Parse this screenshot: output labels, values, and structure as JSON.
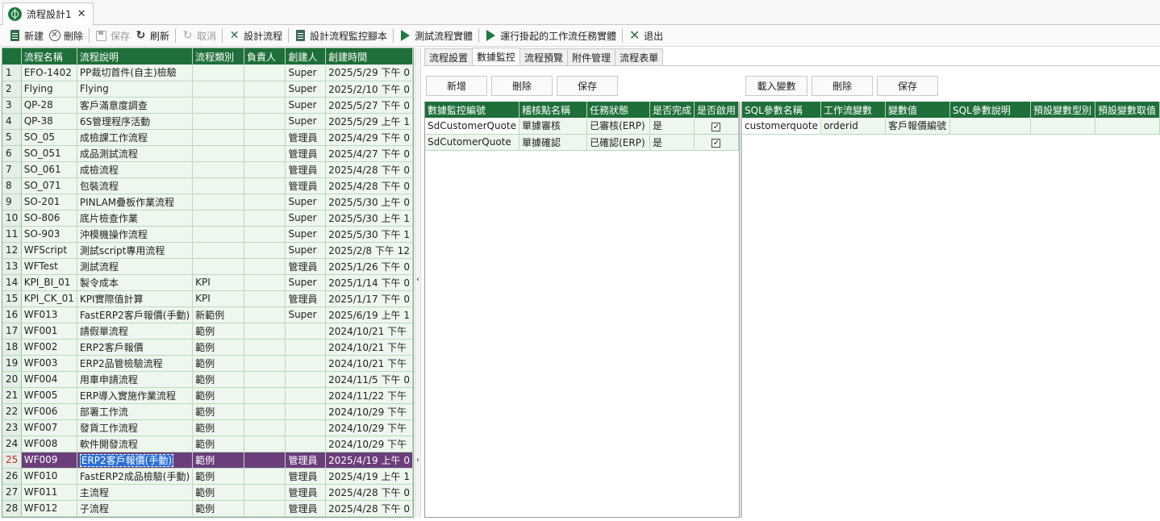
{
  "document_tab": {
    "title": "流程設計1",
    "close": "✕"
  },
  "toolbar": {
    "new": "新建",
    "delete": "刪除",
    "save": "保存",
    "refresh": "刷新",
    "cancel": "取消",
    "design_flow": "設計流程",
    "design_monitor_script": "設計流程監控腳本",
    "test_instance": "測試流程實體",
    "run_pending": "運行掛起的工作流任務實體",
    "exit": "退出"
  },
  "flow_grid": {
    "columns": [
      "流程名稱",
      "流程說明",
      "流程類別",
      "負責人",
      "創建人",
      "創建時間"
    ],
    "selected_row": 25,
    "rows": [
      {
        "n": "1",
        "name": "EFO-1402",
        "desc": "PP裁切首件(自主)檢驗",
        "cat": "",
        "owner": "",
        "creator": "Super",
        "time": "2025/5/29 下午 0"
      },
      {
        "n": "2",
        "name": "Flying",
        "desc": "Flying",
        "cat": "",
        "owner": "",
        "creator": "Super",
        "time": "2025/2/10 下午 0"
      },
      {
        "n": "3",
        "name": "QP-28",
        "desc": "客戶滿意度調查",
        "cat": "",
        "owner": "",
        "creator": "Super",
        "time": "2025/5/27 下午 0"
      },
      {
        "n": "4",
        "name": "QP-38",
        "desc": "6S管理程序活動",
        "cat": "",
        "owner": "",
        "creator": "Super",
        "time": "2025/5/29 上午 1"
      },
      {
        "n": "5",
        "name": "SO_05",
        "desc": "成檢課工作流程",
        "cat": "",
        "owner": "",
        "creator": "管理員",
        "time": "2025/4/29 下午 0"
      },
      {
        "n": "6",
        "name": "SO_051",
        "desc": "成品測試流程",
        "cat": "",
        "owner": "",
        "creator": "管理員",
        "time": "2025/4/27 下午 0"
      },
      {
        "n": "7",
        "name": "SO_061",
        "desc": "成檢流程",
        "cat": "",
        "owner": "",
        "creator": "管理員",
        "time": "2025/4/28 下午 0"
      },
      {
        "n": "8",
        "name": "SO_071",
        "desc": "包裝流程",
        "cat": "",
        "owner": "",
        "creator": "管理員",
        "time": "2025/4/28 下午 0"
      },
      {
        "n": "9",
        "name": "SO-201",
        "desc": "PINLAM疊板作業流程",
        "cat": "",
        "owner": "",
        "creator": "Super",
        "time": "2025/5/30 上午 0"
      },
      {
        "n": "10",
        "name": "SO-806",
        "desc": "底片檢查作業",
        "cat": "",
        "owner": "",
        "creator": "Super",
        "time": "2025/5/30 上午 1"
      },
      {
        "n": "11",
        "name": "SO-903",
        "desc": "沖模機操作流程",
        "cat": "",
        "owner": "",
        "creator": "Super",
        "time": "2025/5/30 下午 1"
      },
      {
        "n": "12",
        "name": "WFScript",
        "desc": "測試script專用流程",
        "cat": "",
        "owner": "",
        "creator": "Super",
        "time": "2025/2/8 下午 12"
      },
      {
        "n": "13",
        "name": "WFTest",
        "desc": "測試流程",
        "cat": "",
        "owner": "",
        "creator": "管理員",
        "time": "2025/1/26 下午 0"
      },
      {
        "n": "14",
        "name": "KPI_BI_01",
        "desc": "製令成本",
        "cat": "KPI",
        "owner": "",
        "creator": "Super",
        "time": "2025/1/14 下午 0"
      },
      {
        "n": "15",
        "name": "KPI_CK_01",
        "desc": "KPI實際值計算",
        "cat": "KPI",
        "owner": "",
        "creator": "管理員",
        "time": "2025/1/17 下午 0"
      },
      {
        "n": "16",
        "name": "WF013",
        "desc": "FastERP2客戶報價(手動)",
        "cat": "新範例",
        "owner": "",
        "creator": "Super",
        "time": "2025/6/19 上午 1"
      },
      {
        "n": "17",
        "name": "WF001",
        "desc": "請假單流程",
        "cat": "範例",
        "owner": "",
        "creator": "",
        "time": "2024/10/21 下午"
      },
      {
        "n": "18",
        "name": "WF002",
        "desc": "ERP2客戶報價",
        "cat": "範例",
        "owner": "",
        "creator": "",
        "time": "2024/10/21 下午"
      },
      {
        "n": "19",
        "name": "WF003",
        "desc": "ERP2品管檢驗流程",
        "cat": "範例",
        "owner": "",
        "creator": "",
        "time": "2024/10/21 下午"
      },
      {
        "n": "20",
        "name": "WF004",
        "desc": "用車申請流程",
        "cat": "範例",
        "owner": "",
        "creator": "",
        "time": "2024/11/5 下午 0"
      },
      {
        "n": "21",
        "name": "WF005",
        "desc": "ERP導入實施作業流程",
        "cat": "範例",
        "owner": "",
        "creator": "",
        "time": "2024/11/22 下午"
      },
      {
        "n": "22",
        "name": "WF006",
        "desc": "部署工作流",
        "cat": "範例",
        "owner": "",
        "creator": "",
        "time": "2024/10/29 下午"
      },
      {
        "n": "23",
        "name": "WF007",
        "desc": "發貨工作流程",
        "cat": "範例",
        "owner": "",
        "creator": "",
        "time": "2024/10/29 下午"
      },
      {
        "n": "24",
        "name": "WF008",
        "desc": "軟件開發流程",
        "cat": "範例",
        "owner": "",
        "creator": "",
        "time": "2024/10/29 下午"
      },
      {
        "n": "25",
        "name": "WF009",
        "desc": "ERP2客戶報價(手動)",
        "cat": "範例",
        "owner": "",
        "creator": "管理員",
        "time": "2025/4/19 上午 0"
      },
      {
        "n": "26",
        "name": "WF010",
        "desc": "FastERP2成品檢驗(手動)",
        "cat": "範例",
        "owner": "",
        "creator": "管理員",
        "time": "2025/4/19 上午 1"
      },
      {
        "n": "27",
        "name": "WF011",
        "desc": "主流程",
        "cat": "範例",
        "owner": "",
        "creator": "管理員",
        "time": "2025/4/28 下午 0"
      },
      {
        "n": "28",
        "name": "WF012",
        "desc": "子流程",
        "cat": "範例",
        "owner": "",
        "creator": "管理員",
        "time": "2025/4/28 下午 0"
      }
    ]
  },
  "right_tabs": [
    "流程設置",
    "數據監控",
    "流程預覽",
    "附件管理",
    "流程表單"
  ],
  "active_tab": 1,
  "monitor_buttons": {
    "add": "新增",
    "delete": "刪除",
    "save": "保存"
  },
  "variable_buttons": {
    "load": "載入變數",
    "delete": "刪除",
    "save": "保存"
  },
  "monitor_grid": {
    "columns": [
      "數據監控編號",
      "稽核點名稱",
      "任務狀態",
      "是否完成",
      "是否啟用"
    ],
    "rows": [
      {
        "id": "SdCustomerQuote",
        "name": "單據審核",
        "status": "已審核(ERP)",
        "done": "是",
        "enabled": true
      },
      {
        "id": "SdCutomerQuote",
        "name": "單據確認",
        "status": "已確認(ERP)",
        "done": "是",
        "enabled": true
      }
    ]
  },
  "variable_grid": {
    "columns": [
      "SQL參數名稱",
      "工作流變數",
      "變數值",
      "SQL參數說明",
      "預設變數型別",
      "預設變數取值"
    ],
    "rows": [
      {
        "param": "customerquote",
        "var": "orderid",
        "value": "客戶報價編號",
        "desc": "",
        "type": "",
        "default": ""
      }
    ]
  }
}
